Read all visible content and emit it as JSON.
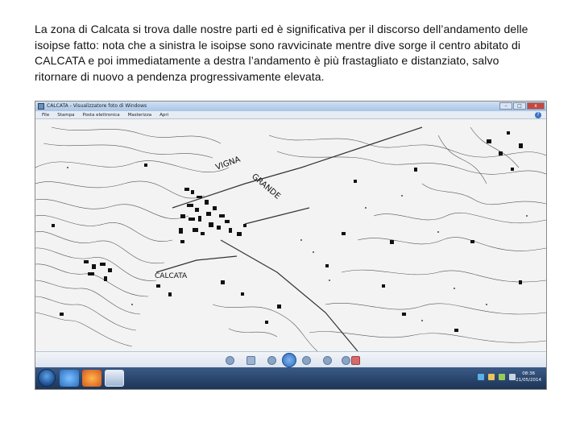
{
  "paragraph": {
    "line1": "La zona di Calcata si trova dalle nostre parti ed è significativa per il discorso dell’andamento delle",
    "line2": "isoipse fatto: nota che a sinistra le isoipse sono ravvicinate mentre dive sorge il centro abitato di",
    "line3": "CALCATA  e poi immediatamente a destra l’andamento è più frastagliato e distanziato, salvo",
    "line4": "ritornare di nuovo a pendenza progressivamente elevata."
  },
  "window": {
    "title": "CALCATA - Visualizzatore foto di Windows",
    "menu": [
      "File",
      "Stampa",
      "Posta elettronica",
      "Masterizza",
      "Apri"
    ],
    "buttons": {
      "minimize": "–",
      "maximize": "□",
      "close": "x"
    }
  },
  "map": {
    "labels": {
      "vigna": "VIGNA",
      "grande": "GRANDE",
      "calcata": "CALCATA"
    }
  },
  "taskbar": {
    "time": "08:36",
    "date": "21/05/2014"
  },
  "colors": {
    "titlebar": "#a9c4e4",
    "taskbar": "#1d3557",
    "accent": "#2d6cbb"
  },
  "icons": [
    "app-icon",
    "help-icon",
    "zoom-icon",
    "fit-icon",
    "previous-icon",
    "play-slideshow-icon",
    "next-icon",
    "rotate-left-icon",
    "rotate-right-icon",
    "delete-icon",
    "start-button-icon",
    "ie-icon",
    "firefox-icon",
    "photo-viewer-icon"
  ]
}
